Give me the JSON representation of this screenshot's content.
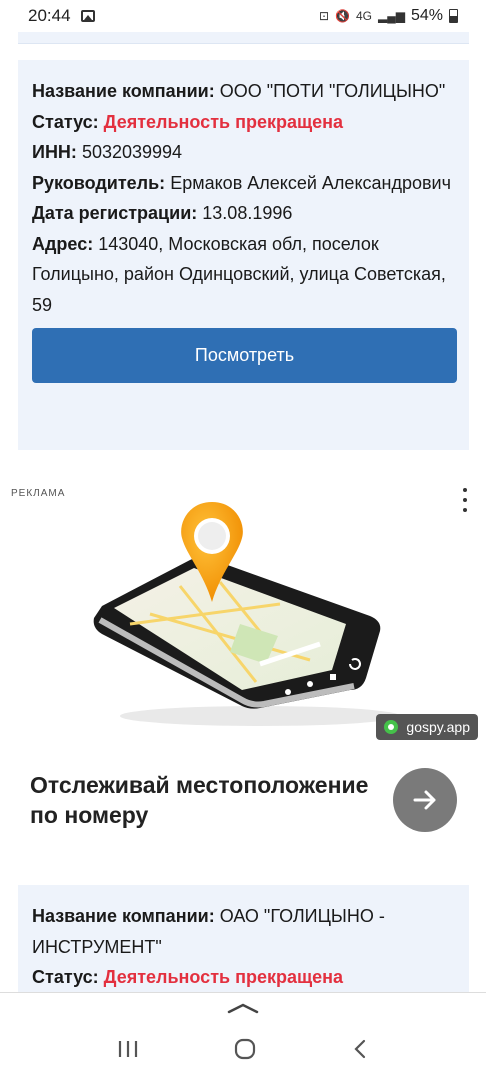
{
  "status_bar": {
    "time": "20:44",
    "network": "4G",
    "battery": "54%"
  },
  "card1": {
    "company_label": "Название компании:",
    "company_value": "ООО \"ПОТИ \"ГОЛИЦЫНО\"",
    "status_label": "Статус:",
    "status_value": "Деятельность прекращена",
    "inn_label": "ИНН:",
    "inn_value": "5032039994",
    "head_label": "Руководитель:",
    "head_value": "Ермаков Алексей Александрович",
    "reg_label": "Дата регистрации:",
    "reg_value": "13.08.1996",
    "addr_label": "Адрес:",
    "addr_value": "143040, Московская обл, поселок Голицыно, район Одинцовский, улица Советская, 59",
    "view_button": "Посмотреть"
  },
  "ad": {
    "label": "РЕКЛАМА",
    "domain": "gospy.app",
    "headline": "Отслеживай местоположение по номеру",
    "colors": {
      "pin": "#f5a00a",
      "button": "#7a7a7a"
    }
  },
  "card2": {
    "company_label": "Название компании:",
    "company_value": "ОАО \"ГОЛИЦЫНО - ИНСТРУМЕНТ\"",
    "status_label": "Статус:",
    "status_value": "Деятельность прекращена"
  },
  "colors": {
    "card_bg": "#eef3fb",
    "accent_button": "#2f6fb4",
    "status_red": "#e3303f"
  }
}
